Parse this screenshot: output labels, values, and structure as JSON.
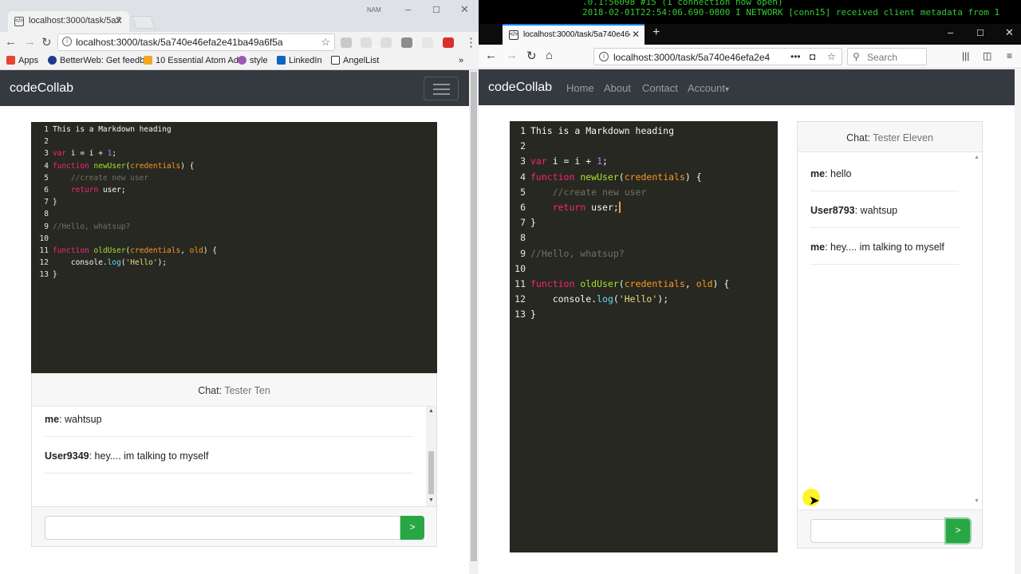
{
  "left_window": {
    "tab_title": "localhost:3000/task/5a7",
    "window_label": "NAM",
    "url": "localhost:3000/task/5a740e46efa2e41ba49a6f5a",
    "bookmarks": [
      "Apps",
      "BetterWeb: Get feedb",
      "10 Essential Atom Ad",
      "style",
      "LinkedIn",
      "AngelList"
    ],
    "bookmark_more": "»",
    "brand": "codeCollab",
    "code_lines": [
      {
        "n": "1",
        "text": "This is a Markdown heading"
      },
      {
        "n": "2",
        "text": ""
      },
      {
        "n": "3",
        "text": "var i = i + 1;"
      },
      {
        "n": "4",
        "text": "function newUser(credentials) {"
      },
      {
        "n": "5",
        "text": "    //create new user"
      },
      {
        "n": "6",
        "text": "    return user;"
      },
      {
        "n": "7",
        "text": "}"
      },
      {
        "n": "8",
        "text": ""
      },
      {
        "n": "9",
        "text": "//Hello, whatsup?"
      },
      {
        "n": "10",
        "text": ""
      },
      {
        "n": "11",
        "text": "function oldUser(credentials, old) {"
      },
      {
        "n": "12",
        "text": "    console.log('Hello');"
      },
      {
        "n": "13",
        "text": "}"
      }
    ],
    "chat": {
      "label": "Chat:",
      "user": "Tester Ten",
      "messages": [
        {
          "sender": "me",
          "text": ": wahtsup"
        },
        {
          "sender": "User9349",
          "text": ": hey.... im talking to myself"
        }
      ],
      "input_value": "",
      "send_label": ">"
    }
  },
  "right_window": {
    "terminal_lines": [
      ".0.1:56098 #15 (1 connection now open)",
      "2018-02-01T22:54:06.690-0800 I NETWORK  [conn15] received client metadata from 1"
    ],
    "tab_title": "localhost:3000/task/5a740e46e",
    "url": "localhost:3000/task/5a740e46efa2e4",
    "search_placeholder": "Search",
    "brand": "codeCollab",
    "nav": [
      "Home",
      "About",
      "Contact",
      "Account"
    ],
    "account_caret": "▾",
    "chat": {
      "label": "Chat:",
      "user": "Tester Eleven",
      "messages": [
        {
          "sender": "me",
          "text": ": hello"
        },
        {
          "sender": "User8793",
          "text": ": wahtsup"
        },
        {
          "sender": "me",
          "text": ": hey.... im talking to myself"
        }
      ],
      "input_value": "",
      "send_label": ">"
    }
  },
  "colors": {
    "editor_bg": "#272822",
    "navbar_bg": "#343a40",
    "send_button": "#28a745",
    "terminal_text": "#33cc33"
  },
  "icons": [
    "back-icon",
    "forward-icon",
    "reload-icon",
    "home-icon",
    "star-icon",
    "search-icon",
    "library-icon",
    "sidebar-icon",
    "menu-icon",
    "close-icon",
    "info-icon"
  ]
}
